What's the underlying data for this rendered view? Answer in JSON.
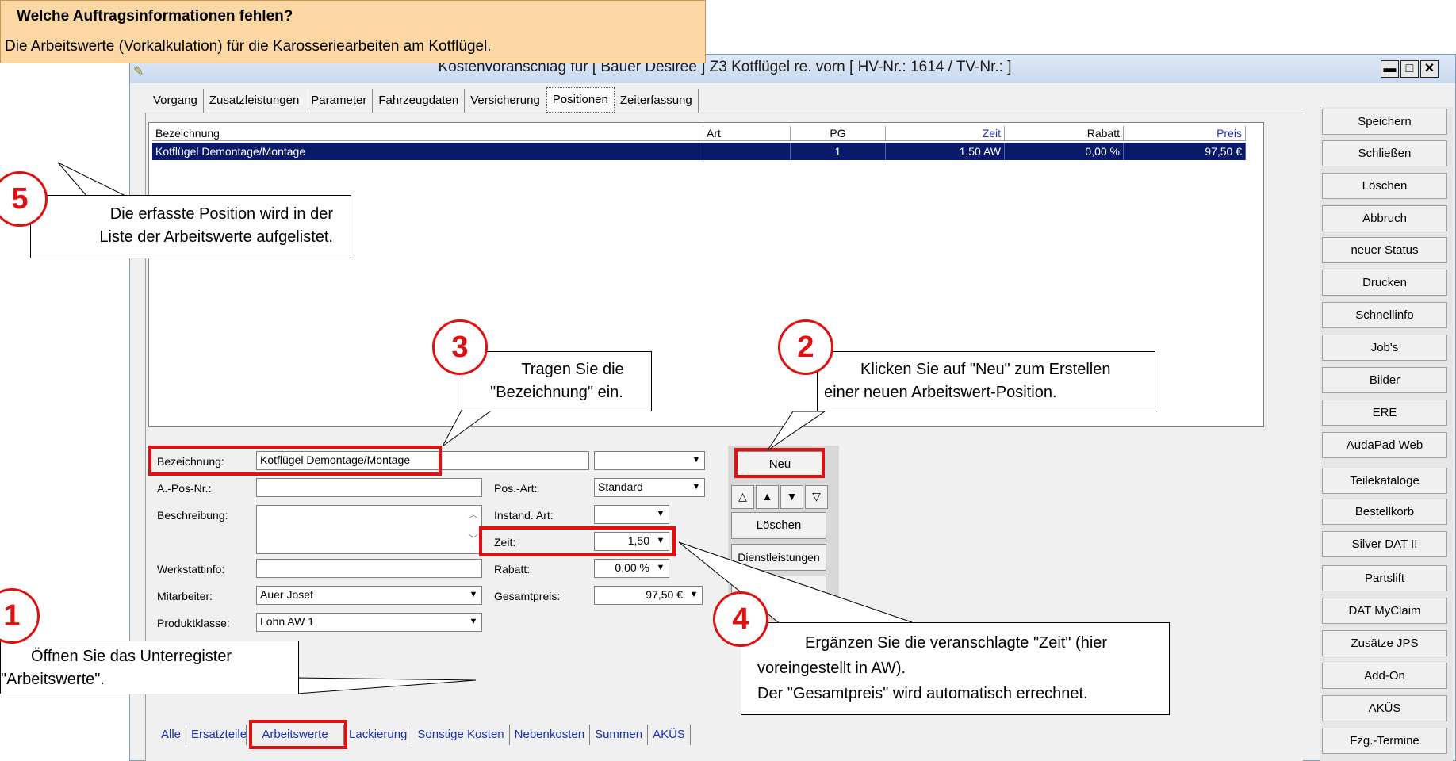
{
  "header": {
    "title": "Welche Auftragsinformationen fehlen?",
    "text": "Die Arbeitswerte (Vorkalkulation) für die Karosseriearbeiten am Kotflügel."
  },
  "window": {
    "title": "Kostenvoranschlag  für [ Bauer Desiree ] Z3 Kotflügel re. vorn [ HV-Nr.: 1614 / TV-Nr.: ]",
    "minimize": "▬",
    "maximize": "□",
    "close": "✕"
  },
  "top_tabs": [
    "Vorgang",
    "Zusatzleistungen",
    "Parameter",
    "Fahrzeugdaten",
    "Versicherung",
    "Positionen",
    "Zeiterfassung"
  ],
  "list": {
    "columns": [
      "Bezeichnung",
      "Art",
      "PG",
      "Zeit",
      "Rabatt",
      "Preis"
    ],
    "rows": [
      {
        "bezeichnung": "Kotflügel Demontage/Montage",
        "art": "",
        "pg": "1",
        "zeit": "1,50 AW",
        "rabatt": "0,00 %",
        "preis": "97,50 €"
      }
    ]
  },
  "form": {
    "bezeichnung_label": "Bezeichnung:",
    "bezeichnung_value": "Kotflügel Demontage/Montage",
    "apos_label": "A.-Pos-Nr.:",
    "beschreibung_label": "Beschreibung:",
    "werkstattinfo_label": "Werkstattinfo:",
    "mitarbeiter_label": "Mitarbeiter:",
    "mitarbeiter_value": "Auer Josef",
    "produktklasse_label": "Produktklasse:",
    "produktklasse_value": "Lohn AW 1",
    "posart_label": "Pos.-Art:",
    "posart_value": "Standard",
    "instand_label": "Instand. Art:",
    "zeit_label": "Zeit:",
    "zeit_value": "1,50",
    "rabatt_label": "Rabatt:",
    "rabatt_value": "0,00 %",
    "gesamtpreis_label": "Gesamtpreis:",
    "gesamtpreis_value": "97,50 €"
  },
  "mid_buttons": {
    "neu": "Neu",
    "loeschen": "Löschen",
    "dienstleistungen": "Dienstleistungen"
  },
  "right_buttons": [
    "Speichern",
    "Schließen",
    "Löschen",
    "Abbruch",
    "neuer Status",
    "Drucken",
    "Schnellinfo",
    "Job's",
    "Bilder",
    "ERE",
    "AudaPad Web",
    "Teilekataloge",
    "Bestellkorb",
    "Silver DAT II",
    "Partslift",
    "DAT MyClaim",
    "Zusätze JPS",
    "Add-On",
    "AKÜS",
    "Fzg.-Termine"
  ],
  "bottom_tabs": [
    "Alle",
    "Ersatzteile",
    "Arbeitswerte",
    "Lackierung",
    "Sonstige Kosten",
    "Nebenkosten",
    "Summen",
    "AKÜS"
  ],
  "callouts": {
    "c1": {
      "num": "1",
      "line1": "Öffnen Sie das Unterregister",
      "line2": "\"Arbeitswerte\"."
    },
    "c2": {
      "num": "2",
      "line1": "Klicken Sie auf \"Neu\" zum Erstellen",
      "line2": "einer neuen Arbeitswert-Position."
    },
    "c3": {
      "num": "3",
      "line1": "Tragen Sie die",
      "line2": "\"Bezeichnung\" ein."
    },
    "c4": {
      "num": "4",
      "line1": "Ergänzen Sie die veranschlagte \"Zeit\"  (hier",
      "line2": "voreingestellt in AW).",
      "line3": "Der \"Gesamtpreis\" wird automatisch errechnet."
    },
    "c5": {
      "num": "5",
      "line1": "Die erfasste Position wird in der",
      "line2": "Liste der Arbeitswerte aufgelistet."
    }
  }
}
